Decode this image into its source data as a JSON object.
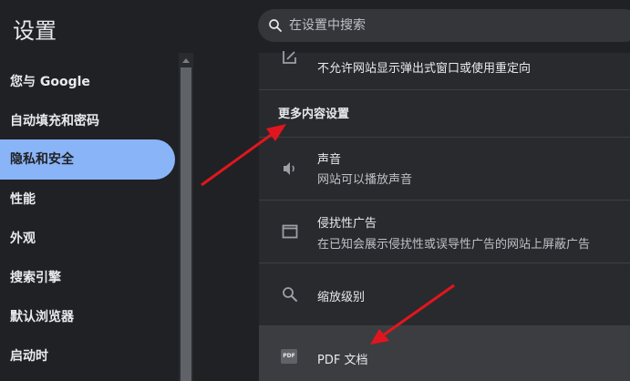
{
  "app_title": "设置",
  "search": {
    "placeholder": "在设置中搜索",
    "icon": "search-icon"
  },
  "sidebar": {
    "items": [
      {
        "label": "您与 Google"
      },
      {
        "label": "自动填充和密码"
      },
      {
        "label": "隐私和安全",
        "active": true
      },
      {
        "label": "性能"
      },
      {
        "label": "外观"
      },
      {
        "label": "搜索引擎"
      },
      {
        "label": "默认浏览器"
      },
      {
        "label": "启动时"
      }
    ]
  },
  "content": {
    "popup_row": {
      "subtitle": "不允许网站显示弹出式窗口或使用重定向",
      "icon": "popup-icon"
    },
    "section_heading": "更多内容设置",
    "rows": [
      {
        "title": "声音",
        "subtitle": "网站可以播放声音",
        "icon": "speaker-icon"
      },
      {
        "title": "侵扰性广告",
        "subtitle": "在已知会展示侵扰性或误导性广告的网站上屏蔽广告",
        "icon": "ads-window-icon"
      },
      {
        "title": "缩放级别",
        "icon": "zoom-icon"
      },
      {
        "title": "PDF 文档",
        "icon": "pdf-icon",
        "icon_text": "PDF"
      }
    ]
  },
  "colors": {
    "accent": "#8ab4f8",
    "annotation_arrow": "#e0161e",
    "background": "#202124",
    "card": "#292a2d"
  }
}
